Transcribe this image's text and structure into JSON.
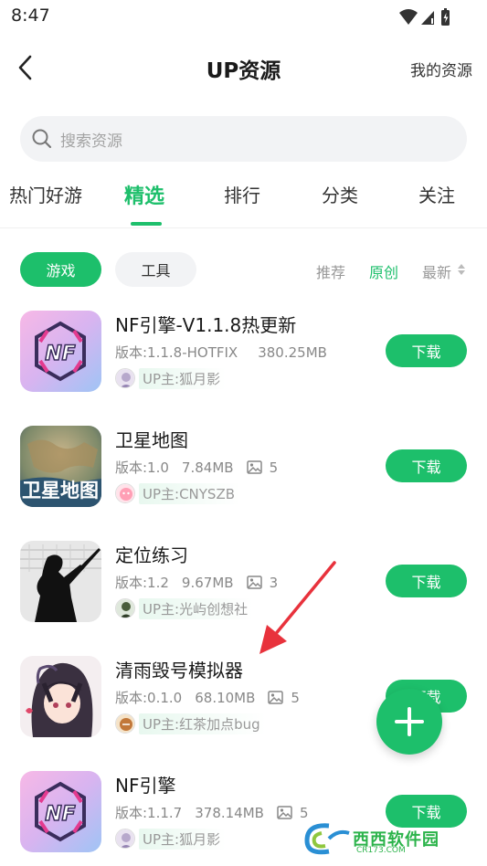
{
  "status_bar": {
    "time": "8:47"
  },
  "header": {
    "title": "UP资源",
    "right_link": "我的资源"
  },
  "search": {
    "placeholder": "搜索资源"
  },
  "tabs": [
    {
      "label": "热门好游",
      "active": false
    },
    {
      "label": "精选",
      "active": true
    },
    {
      "label": "排行",
      "active": false
    },
    {
      "label": "分类",
      "active": false
    },
    {
      "label": "关注",
      "active": false
    }
  ],
  "filters": {
    "chips": [
      {
        "label": "游戏",
        "active": true
      },
      {
        "label": "工具",
        "active": false
      }
    ],
    "sort": [
      {
        "label": "推荐",
        "active": false
      },
      {
        "label": "原创",
        "active": true
      },
      {
        "label": "最新",
        "active": false
      }
    ]
  },
  "apps": [
    {
      "name": "NF引擎-V1.1.8热更新",
      "version": "版本:1.1.8-HOTFIX",
      "size": "380.25MB",
      "images": "",
      "uploader": "UP主:狐月影",
      "download": "下载",
      "icon": "nf-engine-icon"
    },
    {
      "name": "卫星地图",
      "version": "版本:1.0",
      "size": "7.84MB",
      "images": "5",
      "uploader": "UP主:CNYSZB",
      "download": "下载",
      "icon": "satellite-map-icon"
    },
    {
      "name": "定位练习",
      "version": "版本:1.2",
      "size": "9.67MB",
      "images": "3",
      "uploader": "UP主:光屿创想社",
      "download": "下载",
      "icon": "soldier-silhouette-icon"
    },
    {
      "name": "清雨毁号模拟器",
      "version": "版本:0.1.0",
      "size": "68.10MB",
      "images": "5",
      "uploader": "UP主:红茶加点bug",
      "download": "下载",
      "icon": "anime-girl-icon"
    },
    {
      "name": "NF引擎",
      "version": "版本:1.1.7",
      "size": "378.14MB",
      "images": "5",
      "uploader": "UP主:狐月影",
      "download": "下载",
      "icon": "nf-engine-icon"
    }
  ],
  "watermark": {
    "text": "西西软件园",
    "sub": "CR173.COM"
  },
  "colors": {
    "accent": "#1dbf6b",
    "annotation_arrow": "#e8323c"
  }
}
